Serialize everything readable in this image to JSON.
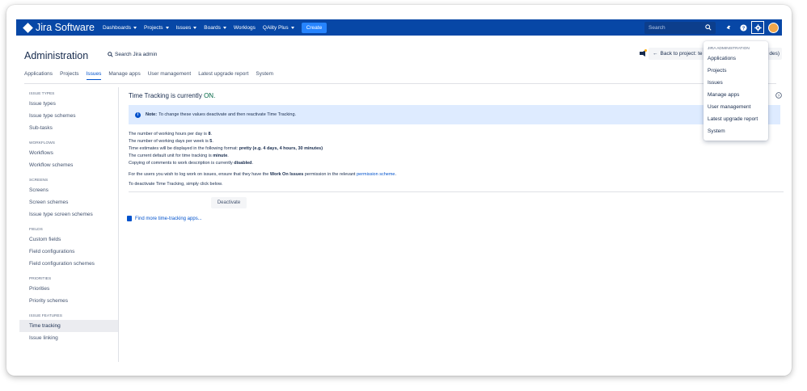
{
  "nav": {
    "logo": "Jira Software",
    "items": [
      "Dashboards",
      "Projects",
      "Issues",
      "Boards",
      "Worklogs",
      "QAlity Plus"
    ],
    "dropdown_flags": [
      true,
      true,
      true,
      true,
      false,
      true
    ],
    "create": "Create",
    "search_placeholder": "Search",
    "icons": [
      "notification-icon",
      "help-icon",
      "gear-icon",
      "avatar"
    ]
  },
  "admin": {
    "title": "Administration",
    "search_label": "Search Jira admin",
    "back_button": "Back to project: te",
    "back_button_tail": "des)",
    "tabs": [
      "Applications",
      "Projects",
      "Issues",
      "Manage apps",
      "User management",
      "Latest upgrade report",
      "System"
    ],
    "active_tab": "Issues"
  },
  "sidebar": {
    "sections": [
      {
        "heading": "ISSUE TYPES",
        "items": [
          "Issue types",
          "Issue type schemes",
          "Sub-tasks"
        ]
      },
      {
        "heading": "WORKFLOWS",
        "items": [
          "Workflows",
          "Workflow schemes"
        ]
      },
      {
        "heading": "SCREENS",
        "items": [
          "Screens",
          "Screen schemes",
          "Issue type screen schemes"
        ]
      },
      {
        "heading": "FIELDS",
        "items": [
          "Custom fields",
          "Field configurations",
          "Field configuration schemes"
        ]
      },
      {
        "heading": "PRIORITIES",
        "items": [
          "Priorities",
          "Priority schemes"
        ]
      },
      {
        "heading": "ISSUE FEATURES",
        "items": [
          "Time tracking",
          "Issue linking"
        ]
      }
    ],
    "active_item": "Time tracking"
  },
  "main": {
    "title_prefix": "Time Tracking is currently",
    "title_status": "ON.",
    "note_label": "Note:",
    "note_text": "To change these values deactivate and then reactivate Time Tracking.",
    "line1_text": "The number of working hours per day is",
    "line1_value": "8",
    "line2_text": "The number of working days per week is",
    "line2_value": "5",
    "line3_text": "Time estimates will be displayed in the following format:",
    "line3_value": "pretty (e.g. 4 days, 4 hours, 30 minutes)",
    "line4_text": "The current default unit for time tracking is",
    "line4_value": "minute",
    "line5_text": "Copying of comments to work description is currently",
    "line5_value": "disabled",
    "perm_pre": "For the users you wish to log work on issues, ensure that they have the",
    "perm_bold": "Work On Issues",
    "perm_mid": "permission in the relevant",
    "perm_link": "permission scheme",
    "deactivate_text": "To deactivate Time Tracking, simply click below.",
    "deactivate_button": "Deactivate",
    "find_apps": "Find more time-tracking apps..."
  },
  "dropdown": {
    "heading": "JIRA ADMINISTRATION",
    "items": [
      "Applications",
      "Projects",
      "Issues",
      "Manage apps",
      "User management",
      "Latest upgrade report",
      "System"
    ]
  },
  "colors": {
    "nav_bg": "#0747a6",
    "accent": "#0052cc",
    "create_btn": "#2684ff",
    "status_on": "#006644",
    "note_bg": "#deebff"
  }
}
